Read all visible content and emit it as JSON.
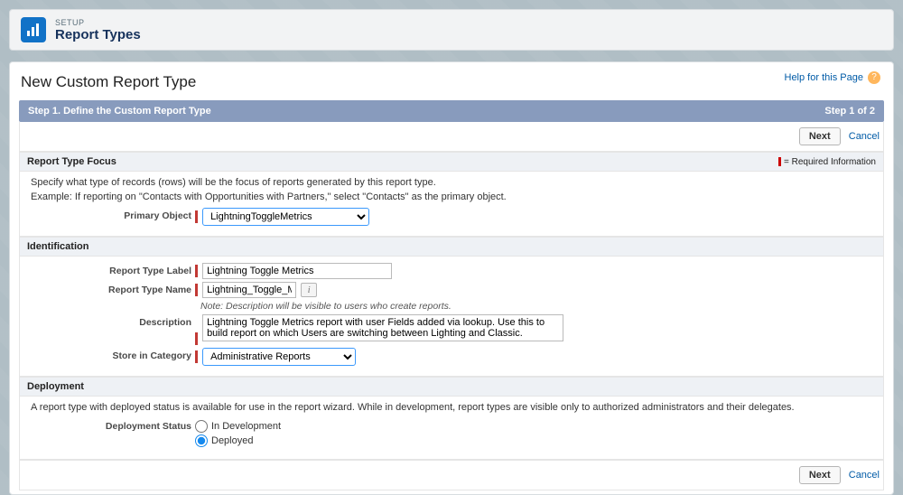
{
  "header": {
    "setup_label": "SETUP",
    "title": "Report Types"
  },
  "page_heading": "New Custom Report Type",
  "help_link_text": "Help for this Page",
  "step": {
    "title": "Step 1. Define the Custom Report Type",
    "progress": "Step 1 of 2"
  },
  "buttons": {
    "next": "Next",
    "cancel": "Cancel"
  },
  "focus": {
    "title": "Report Type Focus",
    "required_info": "= Required Information",
    "line1": "Specify what type of records (rows) will be the focus of reports generated by this report type.",
    "line2": "Example: If reporting on \"Contacts with Opportunities with Partners,\" select \"Contacts\" as the primary object.",
    "primary_label": "Primary Object",
    "primary_value": "LightningToggleMetrics"
  },
  "identification": {
    "title": "Identification",
    "label_label": "Report Type Label",
    "label_value": "Lightning Toggle Metrics",
    "name_label": "Report Type Name",
    "name_value": "Lightning_Toggle_Metric",
    "note": "Note: Description will be visible to users who create reports.",
    "desc_label": "Description",
    "desc_value": "Lightning Toggle Metrics report with user Fields added via lookup. Use this to build report on which Users are switching between Lighting and Classic.",
    "category_label": "Store in Category",
    "category_value": "Administrative Reports"
  },
  "deployment": {
    "title": "Deployment",
    "intro": "A report type with deployed status is available for use in the report wizard. While in development, report types are visible only to authorized administrators and their delegates.",
    "status_label": "Deployment Status",
    "option1": "In Development",
    "option2": "Deployed",
    "selected": "Deployed"
  }
}
